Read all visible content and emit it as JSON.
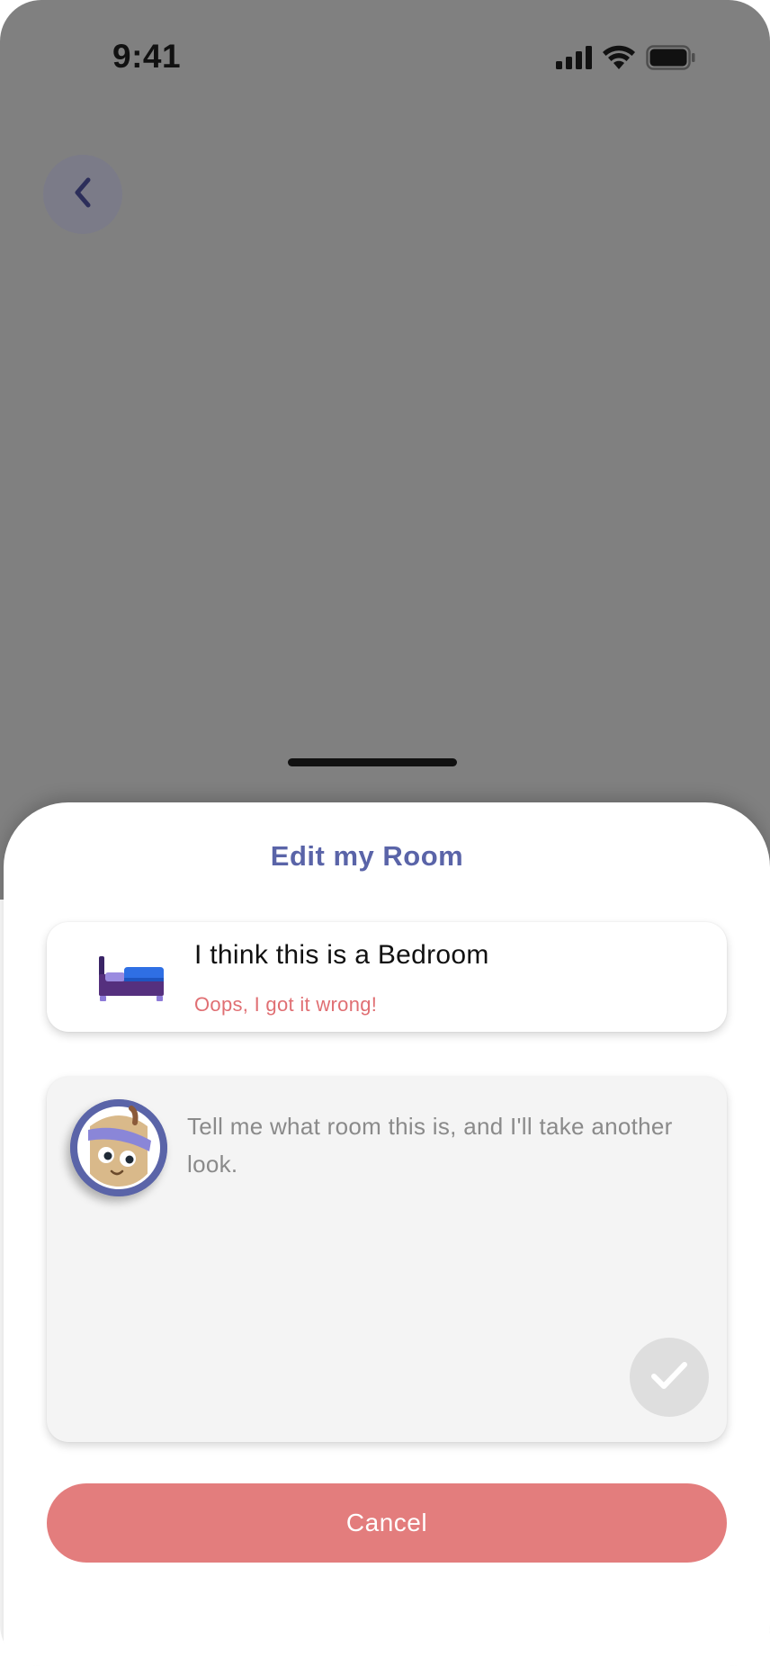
{
  "status_bar": {
    "time": "9:41",
    "icons": [
      "cellular-signal-icon",
      "wifi-icon",
      "battery-icon"
    ]
  },
  "navigation": {
    "back_icon": "chevron-left-icon"
  },
  "sheet": {
    "title": "Edit my Room",
    "detected_room": {
      "icon": "bed-icon",
      "text": "I think this is a Bedroom",
      "wrong_link": "Oops, I got it wrong!"
    },
    "feedback": {
      "avatar": "mascot-avatar",
      "placeholder": "Tell me what room this is, and I'll take another look.",
      "value": "",
      "submit_icon": "checkmark-icon"
    },
    "cancel_label": "Cancel"
  },
  "colors": {
    "accent": "#5a64a8",
    "cancel": "#e37d7d",
    "link": "#e06f73",
    "overlay": "#808080"
  }
}
